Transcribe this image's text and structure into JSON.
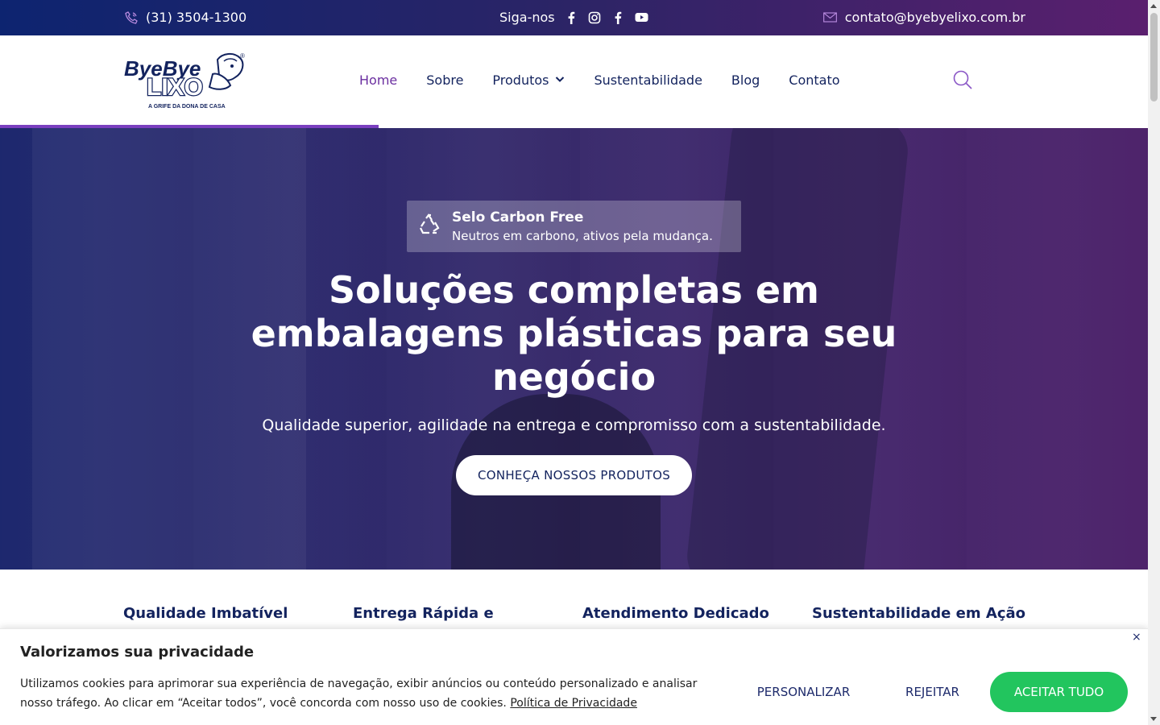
{
  "topbar": {
    "phone": "(31) 3504-1300",
    "follow_label": "Siga-nos",
    "email": "contato@byebyelixo.com.br",
    "icons": [
      "phone-icon",
      "facebook-icon",
      "instagram-icon",
      "facebook-icon",
      "youtube-icon",
      "mail-icon"
    ]
  },
  "header": {
    "logo": {
      "line1": "ByeBye",
      "line2": "LIXO",
      "tagline": "A GRIFE DA DONA DE CASA",
      "reg": "®"
    },
    "nav": [
      {
        "label": "Home",
        "active": true
      },
      {
        "label": "Sobre"
      },
      {
        "label": "Produtos",
        "has_dropdown": true
      },
      {
        "label": "Sustentabilidade"
      },
      {
        "label": "Blog"
      },
      {
        "label": "Contato"
      }
    ],
    "scroll_progress_percent": 33
  },
  "hero": {
    "badge_title": "Selo Carbon Free",
    "badge_subtitle": "Neutros em carbono, ativos pela mudança.",
    "headline": "Soluções completas em embalagens plásticas para seu negócio",
    "subheadline": "Qualidade superior, agilidade na entrega e compromisso com a sustentabilidade.",
    "cta": "CONHEÇA NOSSOS PRODUTOS"
  },
  "features": [
    "Qualidade Imbatível",
    "Entrega Rápida e",
    "Atendimento Dedicado",
    "Sustentabilidade em Ação"
  ],
  "cookie": {
    "title": "Valorizamos sua privacidade",
    "text": "Utilizamos cookies para aprimorar sua experiência de navegação, exibir anúncios ou conteúdo personalizado e analisar nosso tráfego. Ao clicar em “Aceitar todos”, você concorda com nosso uso de cookies.",
    "policy_link": "Política de Privacidade",
    "close": "×",
    "customize": "PERSONALIZAR",
    "reject": "REJEITAR",
    "accept": "ACEITAR TUDO"
  },
  "colors": {
    "brand_navy": "#13235e",
    "brand_purple": "#6b2fa0",
    "accept_green": "#22c55e"
  }
}
